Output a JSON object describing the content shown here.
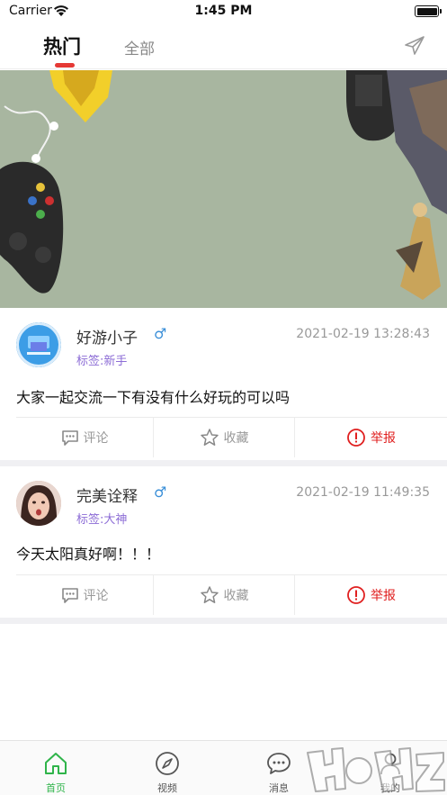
{
  "status_bar": {
    "carrier": "Carrier",
    "time": "1:45 PM"
  },
  "header": {
    "tabs": [
      {
        "label": "热门",
        "active": true
      },
      {
        "label": "全部",
        "active": false
      }
    ],
    "send_icon": "paper-plane-icon"
  },
  "banner": {
    "description_icon": "banner-image"
  },
  "posts": [
    {
      "username": "好游小子",
      "gender": "♂",
      "tag": "标签:新手",
      "time": "2021-02-19 13:28:43",
      "content": "大家一起交流一下有没有什么好玩的可以吗",
      "actions": {
        "comment": "评论",
        "favorite": "收藏",
        "report": "举报"
      }
    },
    {
      "username": "完美诠释",
      "gender": "♂",
      "tag": "标签:大神",
      "time": "2021-02-19 11:49:35",
      "content": "今天太阳真好啊！！！",
      "actions": {
        "comment": "评论",
        "favorite": "收藏",
        "report": "举报"
      }
    }
  ],
  "bottom_nav": [
    {
      "label": "首页",
      "icon": "home-icon",
      "active": true
    },
    {
      "label": "视频",
      "icon": "compass-icon",
      "active": false
    },
    {
      "label": "消息",
      "icon": "chat-icon",
      "active": false
    },
    {
      "label": "我的",
      "icon": "person-icon",
      "active": false
    }
  ],
  "colors": {
    "accent": "#2fb44a",
    "tab_indicator": "#e53935",
    "report": "#e02020",
    "tag": "#8c6cd6",
    "gender": "#3a8fd8"
  }
}
